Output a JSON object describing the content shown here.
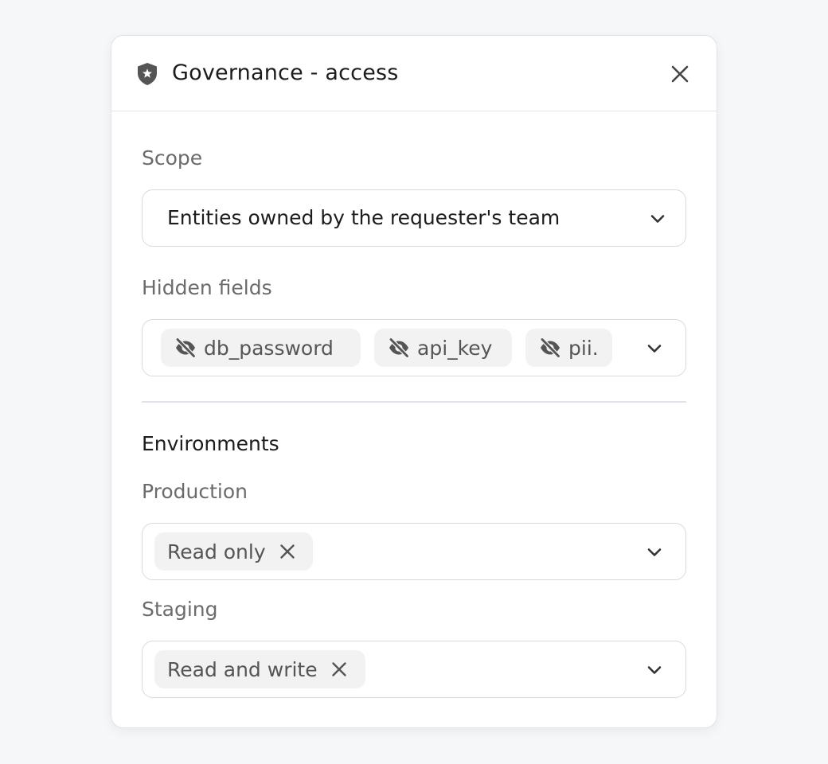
{
  "panel": {
    "title": "Governance - access",
    "icons": {
      "header": "shield-star-icon",
      "close": "close-icon"
    }
  },
  "scope": {
    "label": "Scope",
    "value": "Entities owned by the requester's team"
  },
  "hidden_fields": {
    "label": "Hidden fields",
    "chips": [
      {
        "label": "db_password",
        "icon": "eye-off-icon"
      },
      {
        "label": "api_key",
        "icon": "eye-off-icon"
      },
      {
        "label": "pii.",
        "icon": "eye-off-icon"
      }
    ]
  },
  "environments": {
    "title": "Environments",
    "production": {
      "label": "Production",
      "chip": "Read only"
    },
    "staging": {
      "label": "Staging",
      "chip": "Read and write"
    }
  },
  "colors": {
    "background": "#f6f7f9",
    "panel": "#ffffff",
    "border": "#d9dadd",
    "chip": "#f2f2f3",
    "text": "#1c1c1c",
    "muted": "#6b6b6b"
  }
}
